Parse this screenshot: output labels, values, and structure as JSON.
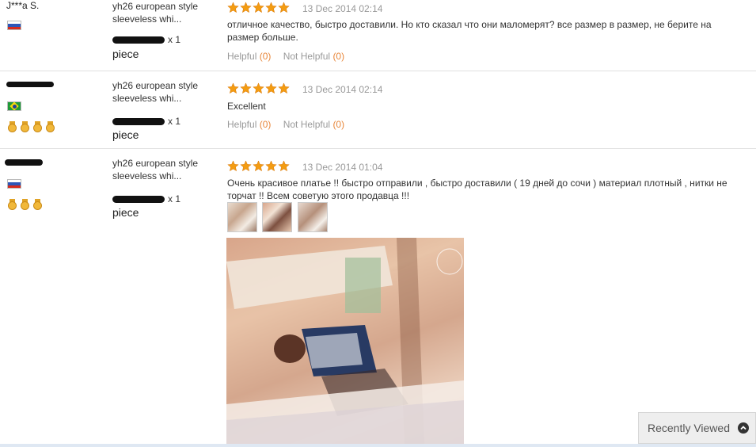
{
  "reviews": [
    {
      "buyer": "J***a S.",
      "country_flag": "russia-flag-icon",
      "product": "yh26 european style sleeveless whi...",
      "qty_suffix": "x 1",
      "piece": "piece",
      "rating": 5,
      "date": "13 Dec 2014 02:14",
      "text": "отличное качество, быстро доставили. Но кто сказал что они маломерят? все размер в размер, не берите на размер больше.",
      "helpful_label": "Helpful",
      "helpful_count": "(0)",
      "not_helpful_label": "Not Helpful",
      "not_helpful_count": "(0)"
    },
    {
      "buyer": "",
      "country_flag": "brazil-flag-icon",
      "medals": 4,
      "product": "yh26 european style sleeveless whi...",
      "qty_suffix": "x 1",
      "piece": "piece",
      "rating": 5,
      "date": "13 Dec 2014 02:14",
      "text": "Excellent",
      "helpful_label": "Helpful",
      "helpful_count": "(0)",
      "not_helpful_label": "Not Helpful",
      "not_helpful_count": "(0)"
    },
    {
      "buyer": "",
      "country_flag": "russia-flag-icon",
      "medals": 3,
      "product": "yh26 european style sleeveless whi...",
      "qty_suffix": "x 1",
      "piece": "piece",
      "rating": 5,
      "date": "13 Dec 2014 01:04",
      "text": "Очень красивое платье !! быстро отправили , быстро доставили ( 19 дней до сочи ) материал плотный , нитки не торчат !! Всем советую этого продавца !!!",
      "thumbnail_count": 3
    }
  ],
  "recently_viewed": {
    "label": "Recently Viewed",
    "icon": "chevron-up-circle-icon"
  },
  "colors": {
    "star": "#f39c12",
    "count": "#e8873b",
    "muted": "#999999"
  }
}
